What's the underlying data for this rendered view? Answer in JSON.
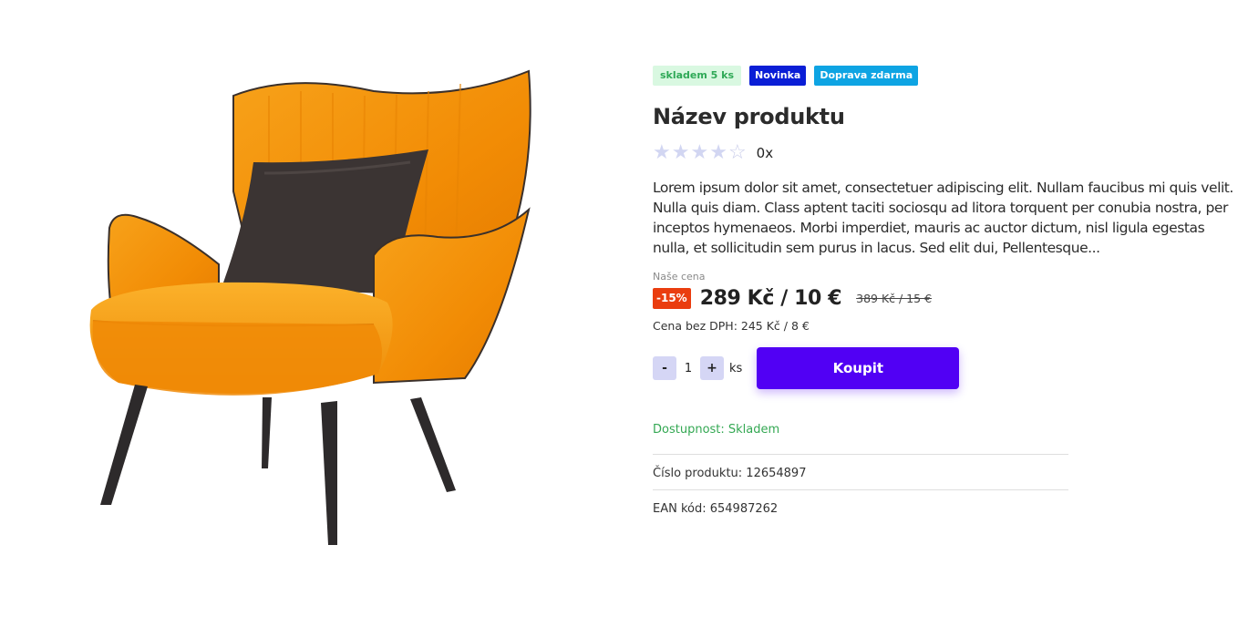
{
  "product": {
    "image_alt": "orange armchair with dark pillow",
    "badges": {
      "stock": "skladem 5 ks",
      "new": "Novinka",
      "shipping": "Doprava zdarma"
    },
    "title": "Název produktu",
    "rating": {
      "stars": 5,
      "count_label": "0x"
    },
    "description": "Lorem ipsum dolor sit amet, consectetuer adipiscing elit. Nullam faucibus mi quis velit. Nulla quis diam. Class aptent taciti sociosqu ad litora torquent per conubia nostra, per inceptos hymenaeos. Morbi imperdiet, mauris ac auctor dictum, nisl ligula egestas nulla, et sollicitudin sem purus in lacus. Sed elit dui, Pellentesque...",
    "price": {
      "label": "Naše cena",
      "discount": "-15%",
      "current": "289 Kč / 10 €",
      "old": "389 Kč / 15 €",
      "net": "Cena bez DPH: 245 Kč / 8 €"
    },
    "purchase": {
      "minus": "-",
      "plus": "+",
      "quantity": "1",
      "unit": "ks",
      "buy_label": "Koupit"
    },
    "meta": {
      "availability": "Dostupnost: Skladem",
      "product_number": "Číslo produktu: 12654897",
      "ean": "EAN kód: 654987262"
    }
  },
  "colors": {
    "accent": "#5100f4",
    "discount": "#ea3d0f",
    "stock_green": "#34a853",
    "new_badge": "#0a1ed6",
    "shipping_badge": "#0ea4e3",
    "chair_orange": "#f5960c"
  }
}
